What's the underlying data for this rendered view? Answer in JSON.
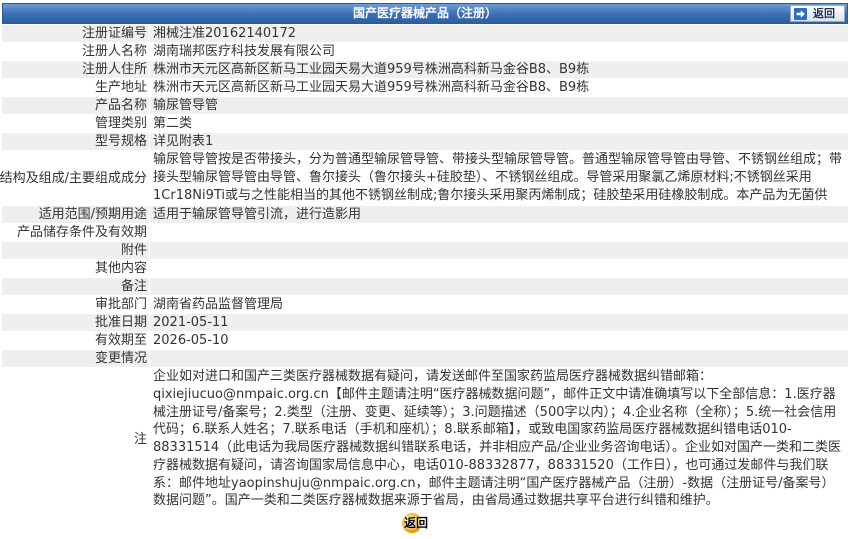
{
  "header": {
    "title": "国产医疗器械产品（注册）",
    "back_label": "返回",
    "back_icon": "arrow-right-icon"
  },
  "fields": [
    {
      "label": "注册证编号",
      "value": "湘械注准20162140172"
    },
    {
      "label": "注册人名称",
      "value": "湖南瑞邦医疗科技发展有限公司"
    },
    {
      "label": "注册人住所",
      "value": "株洲市天元区高新区新马工业园天易大道959号株洲高科新马金谷B8、B9栋"
    },
    {
      "label": "生产地址",
      "value": "株洲市天元区高新区新马工业园天易大道959号株洲高科新马金谷B8、B9栋"
    },
    {
      "label": "产品名称",
      "value": "输尿管导管"
    },
    {
      "label": "管理类别",
      "value": "第二类"
    },
    {
      "label": "型号规格",
      "value": "详见附表1"
    },
    {
      "label": "结构及组成/主要组成成分",
      "value": "输尿管导管按是否带接头，分为普通型输尿管导管、带接头型输尿管导管。普通型输尿管导管由导管、不锈钢丝组成；带接头型输尿管导管由导管、鲁尔接头（鲁尔接头+硅胶垫）、不锈钢丝组成。导管采用聚氯乙烯原材料;不锈钢丝采用1Cr18Ni9Ti或与之性能相当的其他不锈钢丝制成;鲁尔接头采用聚丙烯制成；硅胶垫采用硅橡胶制成。本产品为无菌供应。"
    },
    {
      "label": "适用范围/预期用途",
      "value": "适用于输尿管导管引流，进行造影用"
    },
    {
      "label": "产品储存条件及有效期",
      "value": ""
    },
    {
      "label": "附件",
      "value": ""
    },
    {
      "label": "其他内容",
      "value": ""
    },
    {
      "label": "备注",
      "value": ""
    },
    {
      "label": "审批部门",
      "value": "湖南省药品监督管理局"
    },
    {
      "label": "批准日期",
      "value": "2021-05-11"
    },
    {
      "label": "有效期至",
      "value": "2026-05-10"
    },
    {
      "label": "变更情况",
      "value": ""
    },
    {
      "label": "注",
      "value": "企业如对进口和国产三类医疗器械数据有疑问，请发送邮件至国家药监局医疗器械数据纠错邮箱：qixiejiucuo@nmpaic.org.cn【邮件主题请注明“医疗器械数据问题”，邮件正文中请准确填写以下全部信息：1.医疗器械注册证号/备案号；2.类型（注册、变更、延续等）；3.问题描述（500字以内）；4.企业名称（全称）；5.统一社会信用代码；6.联系人姓名；7.联系电话（手机和座机）；8.联系邮箱】，或致电国家药监局医疗器械数据纠错电话010-88331514（此电话为我局医疗器械数据纠错联系电话，并非相应产品/企业业务咨询电话）。企业如对国产一类和二类医疗器械数据有疑问，请咨询国家局信息中心，电话010-88332877，88331520（工作日），也可通过发邮件与我们联系：邮件地址yaopinshuju@nmpaic.org.cn，邮件主题请注明“国产医疗器械产品（注册）-数据（注册证号/备案号）数据问题”。国产一类和二类医疗器械数据来源于省局，由省局通过数据共享平台进行纠错和维护。"
    }
  ],
  "footer": {
    "back_label": "返回",
    "back_icon": "orange-circle-icon"
  },
  "colors": {
    "header_bar": "#3a6db2",
    "row_alt": "#efefef",
    "text": "#333333",
    "back_button_ball": "#f5a300"
  }
}
